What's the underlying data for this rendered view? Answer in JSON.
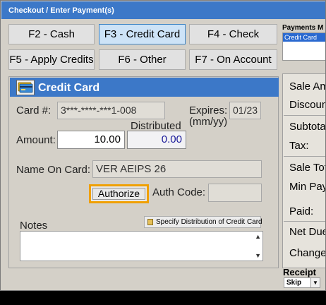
{
  "window": {
    "title": "Checkout / Enter Payment(s)"
  },
  "function_buttons": [
    {
      "label": "F2 - Cash"
    },
    {
      "label": "F3 - Credit Card"
    },
    {
      "label": "F4 - Check"
    },
    {
      "label": "F5 - Apply Credits"
    },
    {
      "label": "F6 - Other"
    },
    {
      "label": "F7 - On Account"
    }
  ],
  "payments_panel": {
    "label": "Payments M",
    "items": [
      "Credit Card"
    ]
  },
  "credit_card": {
    "header": "Credit Card",
    "card_label": "Card #:",
    "card_number": "3***-****-***1-008",
    "expires_label": "Expires:",
    "expires_format": "(mm/yy)",
    "expires_value": "01/23",
    "distributed_label": "Distributed",
    "amount_label": "Amount:",
    "amount_value": "10.00",
    "distributed_value": "0.00",
    "name_label": "Name On Card:",
    "name_value": "VER AEIPS 26",
    "authorize_label": "Authorize",
    "auth_code_label": "Auth Code:",
    "auth_code_value": "",
    "specify_label": "Specify Distribution of Credit Card",
    "notes_label": "Notes",
    "notes_value": ""
  },
  "summary": {
    "rows": [
      "Sale Am",
      "Discoun",
      "Subtota",
      "Tax:",
      "Sale Tot",
      "Min Pay",
      "Paid:",
      "Net Due",
      "Change"
    ]
  },
  "receipt": {
    "label": "Receipt",
    "value": "Skip"
  },
  "colors": {
    "title_bar": "#3c78c8",
    "highlight": "#f0a000",
    "selected_button": "#cde3f7"
  }
}
